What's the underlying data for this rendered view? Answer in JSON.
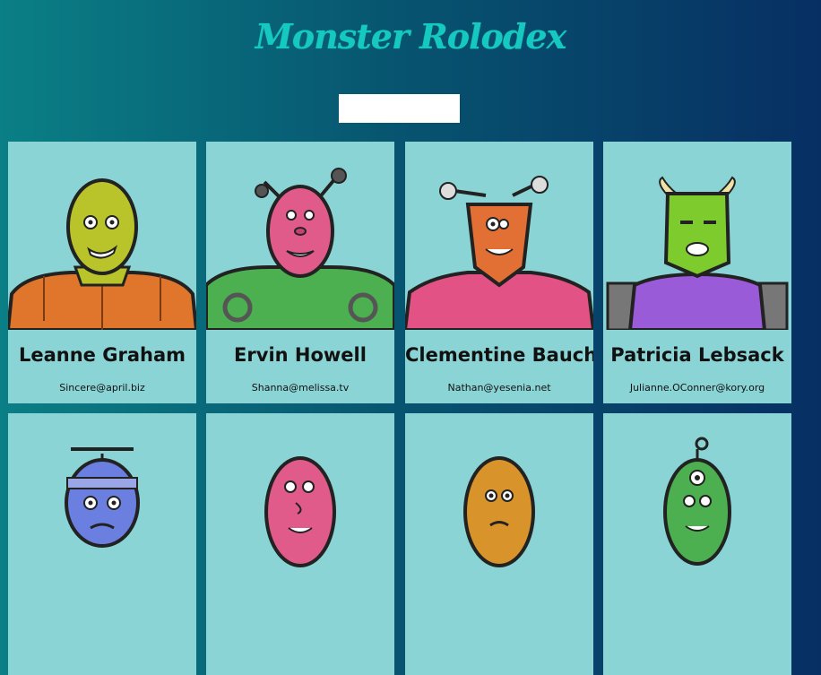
{
  "app": {
    "title": "Monster Rolodex"
  },
  "search": {
    "placeholder": "",
    "value": ""
  },
  "monsters": [
    {
      "name": "Leanne Graham",
      "email": "Sincere@april.biz",
      "skin": "#b8c42a",
      "body": "#e0752c"
    },
    {
      "name": "Ervin Howell",
      "email": "Shanna@melissa.tv",
      "skin": "#e05a8a",
      "body": "#4caf50"
    },
    {
      "name": "Clementine Bauch",
      "email": "Nathan@yesenia.net",
      "skin": "#e27035",
      "body": "#e25284"
    },
    {
      "name": "Patricia Lebsack",
      "email": "Julianne.OConner@kory.org",
      "skin": "#7ecb2e",
      "body": "#9a5bd8"
    },
    {
      "skin": "#6b7fe0",
      "body": "#6b7fe0"
    },
    {
      "skin": "#e05a8a",
      "body": "#e05a8a"
    },
    {
      "skin": "#d8942a",
      "body": "#d8942a"
    },
    {
      "skin": "#4caf50",
      "body": "#4caf50"
    }
  ]
}
